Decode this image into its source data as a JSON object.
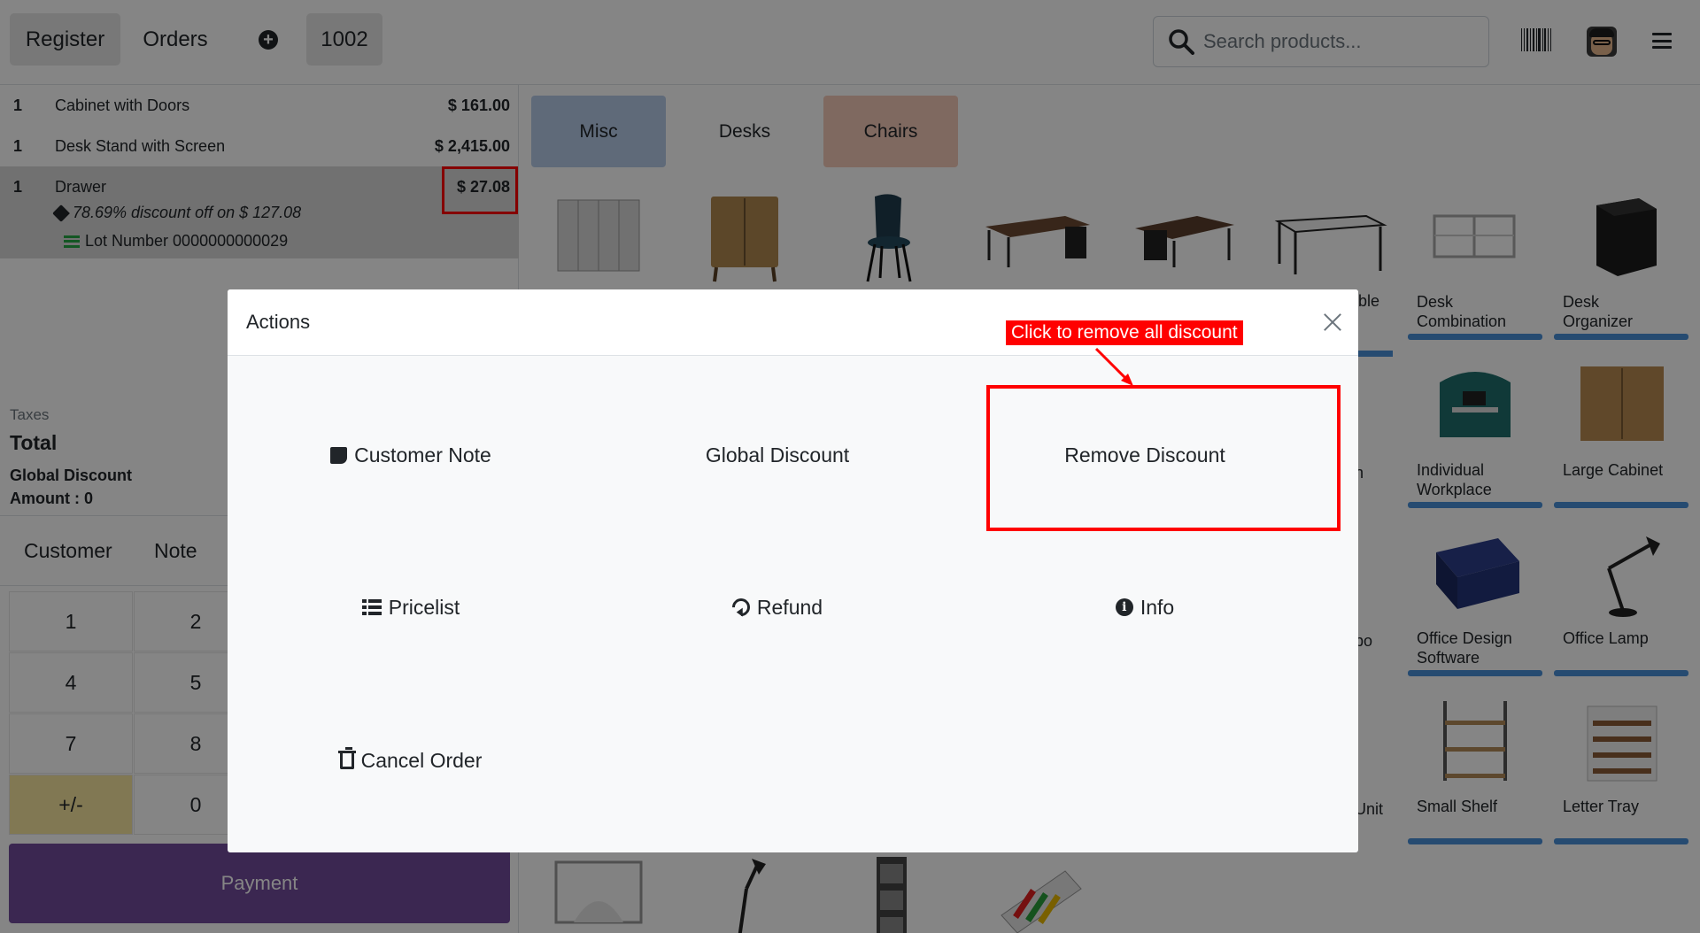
{
  "topbar": {
    "register_label": "Register",
    "orders_label": "Orders",
    "order_number": "1002",
    "search_placeholder": "Search products..."
  },
  "orderlines": [
    {
      "qty": "1",
      "name": "Cabinet with Doors",
      "price": "$ 161.00"
    },
    {
      "qty": "1",
      "name": "Desk Stand with Screen",
      "price": "$ 2,415.00"
    },
    {
      "qty": "1",
      "name": "Drawer",
      "price": "$ 27.08",
      "discount": "78.69% discount off on $ 127.08",
      "lot": "Lot Number 0000000000029"
    }
  ],
  "summary": {
    "taxes_label": "Taxes",
    "total_label": "Total",
    "global_discount_label": "Global Discount",
    "amount_label": "Amount : 0"
  },
  "controls": {
    "customer_label": "Customer",
    "note_label": "Note",
    "numpad": [
      "1",
      "2",
      "4",
      "5",
      "7",
      "8",
      "+/-",
      "0"
    ],
    "payment_label": "Payment"
  },
  "categories": [
    "Misc",
    "Desks",
    "Chairs"
  ],
  "products": [
    {
      "name": ""
    },
    {
      "name": ""
    },
    {
      "name": ""
    },
    {
      "name": ""
    },
    {
      "name": ""
    },
    {
      "name": ""
    },
    {
      "name": "Desk Combination"
    },
    {
      "name": "Desk Organizer"
    },
    {
      "name": "Individual Workplace"
    },
    {
      "name": "Large Cabinet"
    },
    {
      "name": "Office Design Software"
    },
    {
      "name": "Office Lamp"
    },
    {
      "name": "Small Shelf"
    },
    {
      "name": "Letter Tray"
    }
  ],
  "partial_labels": [
    "ble",
    "n",
    "bo",
    "Unit"
  ],
  "modal": {
    "title": "Actions",
    "actions": {
      "customer_note": "Customer Note",
      "global_discount": "Global Discount",
      "remove_discount": "Remove Discount",
      "pricelist": "Pricelist",
      "refund": "Refund",
      "info": "Info",
      "cancel_order": "Cancel Order"
    }
  },
  "annotation": {
    "callout_text": "Click to remove all discount",
    "highlight_color": "#ff0000"
  },
  "colors": {
    "payment": "#714b9c",
    "misc_category": "#b6cbe8",
    "chairs_category": "#f4c9b8",
    "numpad_sign": "#f7e6a0"
  }
}
